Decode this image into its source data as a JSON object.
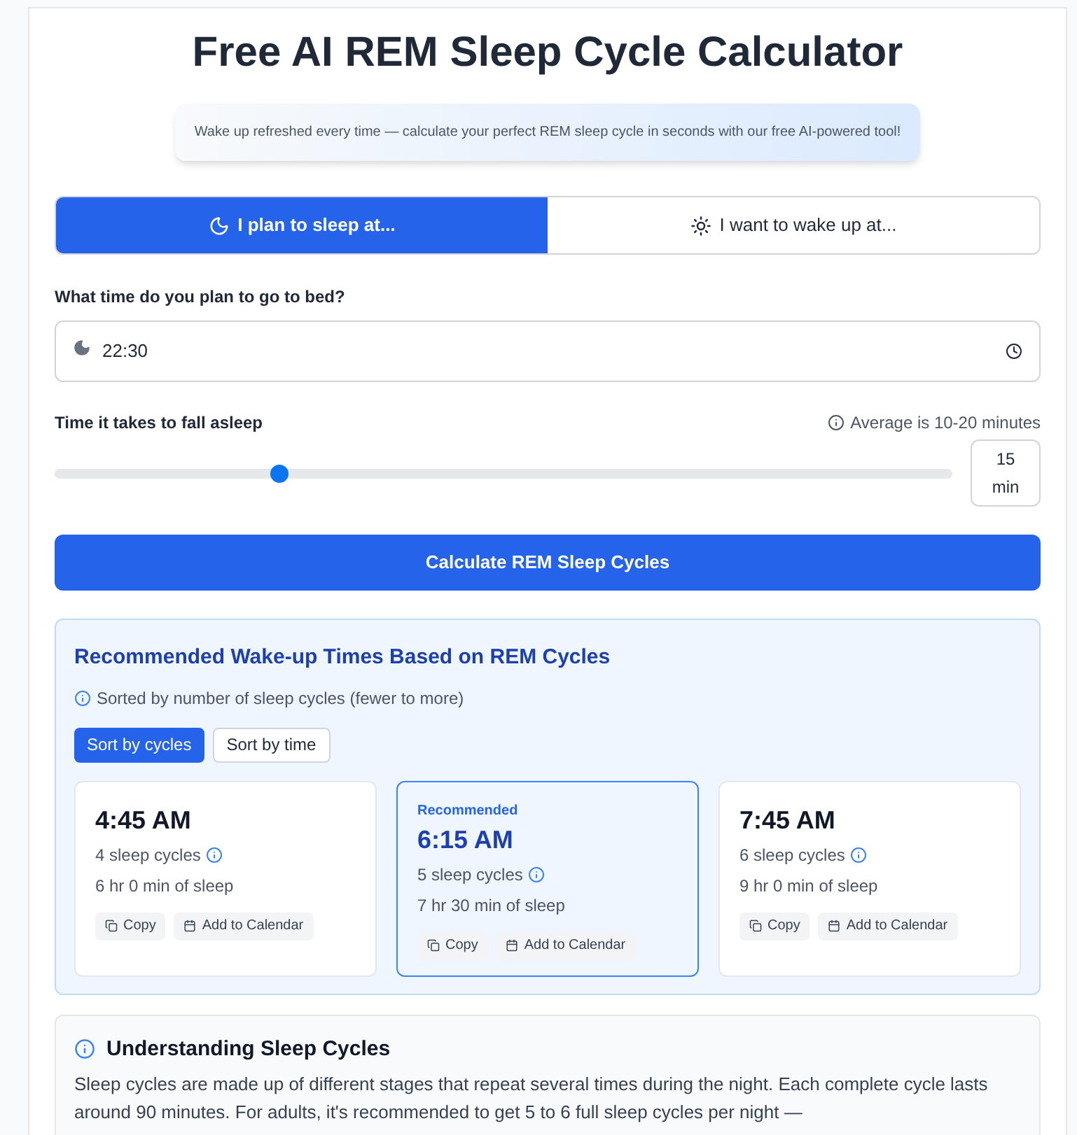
{
  "title": "Free AI REM Sleep Cycle Calculator",
  "tagline": "Wake up refreshed every time — calculate your perfect REM sleep cycle in seconds with our free AI-powered tool!",
  "modes": [
    {
      "label": "I plan to sleep at...",
      "kind": "moon",
      "selected": true
    },
    {
      "label": "I want to wake up at...",
      "kind": "sun",
      "selected": false
    }
  ],
  "bedtime": {
    "label": "What time do you plan to go to bed?",
    "value": "22:30"
  },
  "fall_asleep": {
    "label": "Time it takes to fall asleep",
    "hint": "Average is 10-20 minutes",
    "level": 0.25,
    "value": "15",
    "unit": "min"
  },
  "calculate_button": "Calculate REM Sleep Cycles",
  "results": {
    "title": "Recommended Wake-up Times Based on REM Cycles",
    "note": "Sorted by number of sleep cycles (fewer to more)",
    "sort": [
      {
        "label": "Sort by cycles",
        "selected": true
      },
      {
        "label": "Sort by time",
        "selected": false
      }
    ],
    "cards": [
      {
        "recommended": false,
        "time": "4:45 AM",
        "cycles": "4 sleep cycles",
        "duration": "6 hr 0 min of sleep",
        "copy": "Copy",
        "calendar": "Add to Calendar"
      },
      {
        "recommended": true,
        "badge": "Recommended",
        "time": "6:15 AM",
        "cycles": "5 sleep cycles",
        "duration": "7 hr 30 min of sleep",
        "copy": "Copy",
        "calendar": "Add to Calendar"
      },
      {
        "recommended": false,
        "time": "7:45 AM",
        "cycles": "6 sleep cycles",
        "duration": "9 hr 0 min of sleep",
        "copy": "Copy",
        "calendar": "Add to Calendar"
      }
    ]
  },
  "info": {
    "title": "Understanding Sleep Cycles",
    "text": "Sleep cycles are made up of different stages that repeat several times during the night. Each complete cycle lasts around 90 minutes. For adults, it's recommended to get 5 to 6 full sleep cycles per night —"
  }
}
